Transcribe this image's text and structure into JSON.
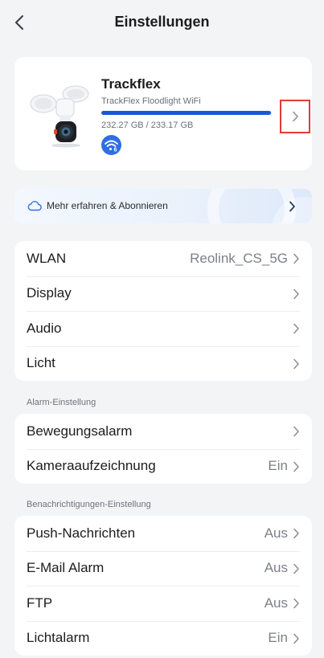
{
  "header": {
    "title": "Einstellungen",
    "back_icon": "chevron-left-icon"
  },
  "device": {
    "name": "Trackflex",
    "model": "TrackFlex Floodlight WiFi",
    "storage_text": "232.27 GB / 233.17 GB",
    "storage_used_fraction": 0.996,
    "wifi_badge_label": "6",
    "colors": {
      "accent": "#1a56db",
      "highlight_border": "#e03c3c"
    }
  },
  "banner": {
    "label": "Mehr erfahren & Abonnieren",
    "icon": "cloud-icon"
  },
  "general": {
    "items": [
      {
        "label": "WLAN",
        "value": "Reolink_CS_5G"
      },
      {
        "label": "Display",
        "value": ""
      },
      {
        "label": "Audio",
        "value": ""
      },
      {
        "label": "Licht",
        "value": ""
      }
    ]
  },
  "alarm": {
    "title": "Alarm-Einstellung",
    "items": [
      {
        "label": "Bewegungsalarm",
        "value": ""
      },
      {
        "label": "Kameraaufzeichnung",
        "value": "Ein"
      }
    ]
  },
  "notifications": {
    "title": "Benachrichtigungen-Einstellung",
    "items": [
      {
        "label": "Push-Nachrichten",
        "value": "Aus"
      },
      {
        "label": "E-Mail Alarm",
        "value": "Aus"
      },
      {
        "label": "FTP",
        "value": "Aus"
      },
      {
        "label": "Lichtalarm",
        "value": "Ein"
      }
    ]
  }
}
